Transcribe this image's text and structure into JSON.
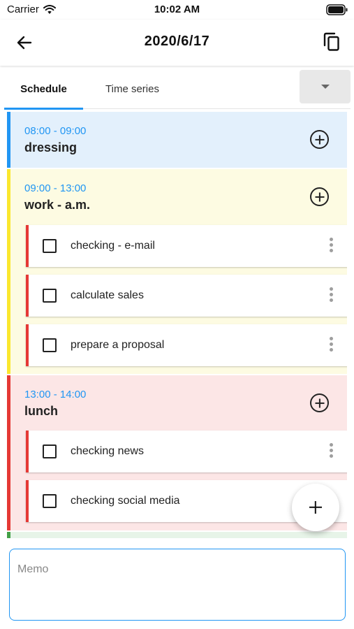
{
  "status_bar": {
    "carrier": "Carrier",
    "time": "10:02 AM"
  },
  "app_bar": {
    "title": "2020/6/17",
    "back_icon": "arrow-left-icon",
    "copy_icon": "copy-icon"
  },
  "tabs": [
    {
      "label": "Schedule",
      "active": true
    },
    {
      "label": "Time series",
      "active": false
    }
  ],
  "schedule": [
    {
      "time": "08:00 - 09:00",
      "title": "dressing",
      "color": "#2196f3",
      "bg": "#e3f0fc",
      "tasks": []
    },
    {
      "time": "09:00 - 13:00",
      "title": "work - a.m.",
      "color": "#fbe72e",
      "bg": "#fdfbe2",
      "tasks": [
        {
          "label": "checking - e-mail"
        },
        {
          "label": "calculate sales"
        },
        {
          "label": "prepare a proposal"
        }
      ]
    },
    {
      "time": "13:00 - 14:00",
      "title": "lunch",
      "color": "#e53935",
      "bg": "#fce6e6",
      "tasks": [
        {
          "label": "checking news"
        },
        {
          "label": "checking social media"
        }
      ]
    },
    {
      "color": "#43a047",
      "bg": "#e7f4e8"
    }
  ],
  "task_accent": "#e53935",
  "memo": {
    "placeholder": "Memo",
    "value": ""
  },
  "colors": {
    "accent": "#2196f3"
  }
}
